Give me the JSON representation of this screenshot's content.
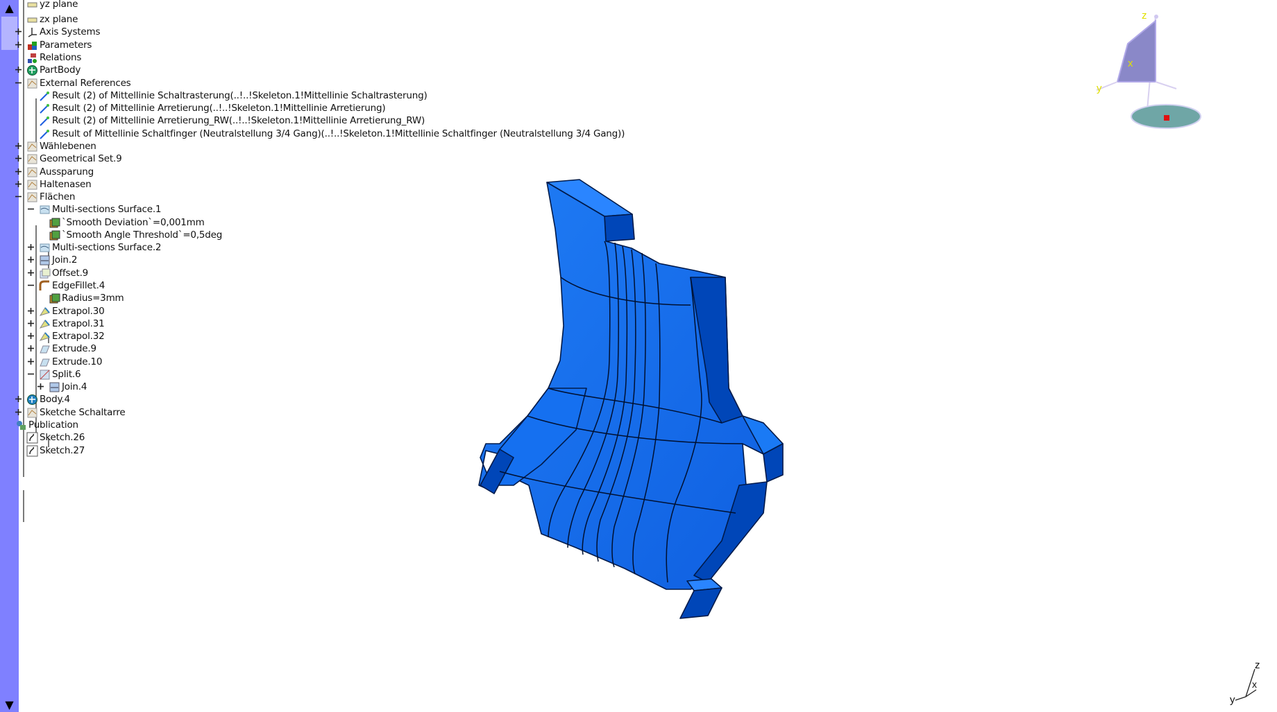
{
  "tree": {
    "nodes": [
      {
        "label": "yz plane",
        "icon": "plane-icon"
      },
      {
        "label": "zx plane",
        "icon": "plane-icon"
      },
      {
        "label": "Axis Systems",
        "icon": "axis-system-icon"
      },
      {
        "label": "Parameters",
        "icon": "parameters-icon"
      },
      {
        "label": "Relations",
        "icon": "relations-icon"
      },
      {
        "label": "PartBody",
        "icon": "partbody-icon"
      },
      {
        "label": "External References",
        "icon": "geometrical-set-icon"
      },
      {
        "label": "Result (2) of Mittellinie Schaltrasterung(..!..!Skeleton.1!Mittellinie Schaltrasterung)",
        "icon": "external-reference-icon"
      },
      {
        "label": "Result (2) of Mittellinie Arretierung(..!..!Skeleton.1!Mittellinie Arretierung)",
        "icon": "external-reference-icon"
      },
      {
        "label": "Result (2) of Mittellinie Arretierung_RW(..!..!Skeleton.1!Mittellinie Arretierung_RW)",
        "icon": "external-reference-icon"
      },
      {
        "label": "Result of Mittellinie Schaltfinger (Neutralstellung 3/4 Gang)(..!..!Skeleton.1!Mittellinie Schaltfinger (Neutralstellung 3/4 Gang))",
        "icon": "external-reference-icon"
      },
      {
        "label": "Wählebenen",
        "icon": "geometrical-set-icon"
      },
      {
        "label": "Geometrical Set.9",
        "icon": "geometrical-set-icon"
      },
      {
        "label": "Aussparung",
        "icon": "geometrical-set-icon"
      },
      {
        "label": "Haltenasen",
        "icon": "geometrical-set-icon"
      },
      {
        "label": "Flächen",
        "icon": "geometrical-set-icon"
      },
      {
        "label": "Multi-sections Surface.1",
        "icon": "multi-sections-surface-icon"
      },
      {
        "label": "`Smooth Deviation`=0,001mm",
        "icon": "parameter-value-icon"
      },
      {
        "label": "`Smooth Angle Threshold`=0,5deg",
        "icon": "parameter-value-icon"
      },
      {
        "label": "Multi-sections Surface.2",
        "icon": "multi-sections-surface-icon"
      },
      {
        "label": "Join.2",
        "icon": "join-icon"
      },
      {
        "label": "Offset.9",
        "icon": "offset-icon"
      },
      {
        "label": "EdgeFillet.4",
        "icon": "edge-fillet-icon"
      },
      {
        "label": "Radius=3mm",
        "icon": "parameter-value-icon"
      },
      {
        "label": "Extrapol.30",
        "icon": "extrapolate-icon"
      },
      {
        "label": "Extrapol.31",
        "icon": "extrapolate-icon"
      },
      {
        "label": "Extrapol.32",
        "icon": "extrapolate-icon"
      },
      {
        "label": "Extrude.9",
        "icon": "extrude-icon"
      },
      {
        "label": "Extrude.10",
        "icon": "extrude-icon"
      },
      {
        "label": "Split.6",
        "icon": "split-icon"
      },
      {
        "label": "Join.4",
        "icon": "join-icon"
      },
      {
        "label": "Body.4",
        "icon": "body-icon"
      },
      {
        "label": "Sketche Schaltarre",
        "icon": "geometrical-set-icon"
      },
      {
        "label": "Publication",
        "icon": "publication-icon"
      },
      {
        "label": "Sketch.26",
        "icon": "sketch-icon"
      },
      {
        "label": "Sketch.27",
        "icon": "sketch-icon"
      }
    ]
  },
  "compass": {
    "x_label": "x",
    "y_label": "y",
    "z_label": "z"
  },
  "mini_axis": {
    "x_label": "x",
    "y_label": "y",
    "z_label": "z"
  },
  "colors": {
    "part_blue": "#0f6cf0",
    "scrollbar": "#7f80ff",
    "compass_fill": "#8a88c8",
    "axis_label": "#e0e000"
  }
}
